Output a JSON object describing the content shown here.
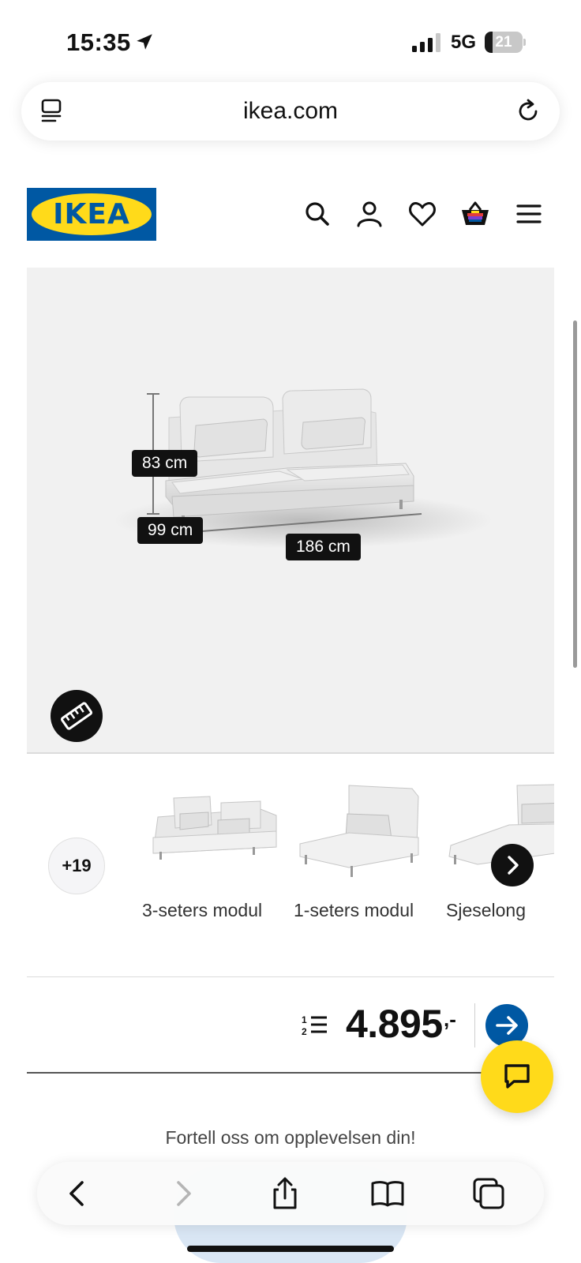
{
  "status_bar": {
    "time": "15:35",
    "network": "5G",
    "battery_level": "21",
    "battery_fraction": 0.21
  },
  "browser": {
    "url": "ikea.com",
    "icons": {
      "left": "reader-tabs-icon",
      "right": "reload-icon"
    }
  },
  "header": {
    "logo_text": "IKEA",
    "brand_blue": "#0058a3",
    "brand_yellow": "#ffda1a",
    "icons": [
      "search-icon",
      "account-icon",
      "favorites-icon",
      "basket-icon",
      "menu-icon"
    ]
  },
  "product_image": {
    "dimensions": {
      "height": "83 cm",
      "depth": "99 cm",
      "width": "186 cm"
    },
    "measure_button_icon": "ruler-icon"
  },
  "variants": {
    "more_count": "+19",
    "items": [
      {
        "label": "3-seters modul"
      },
      {
        "label": "1-seters modul"
      },
      {
        "label": "Sjeselong"
      }
    ]
  },
  "price": {
    "installment_icon": "installment-list-icon",
    "value": "4.895",
    "suffix": ",-"
  },
  "chat_icon": "chat-icon",
  "feedback_text": "Fortell oss om opplevelsen din!",
  "toolbar": {
    "icons": [
      "back-icon",
      "forward-icon",
      "share-icon",
      "bookmarks-icon",
      "tabs-icon"
    ]
  }
}
